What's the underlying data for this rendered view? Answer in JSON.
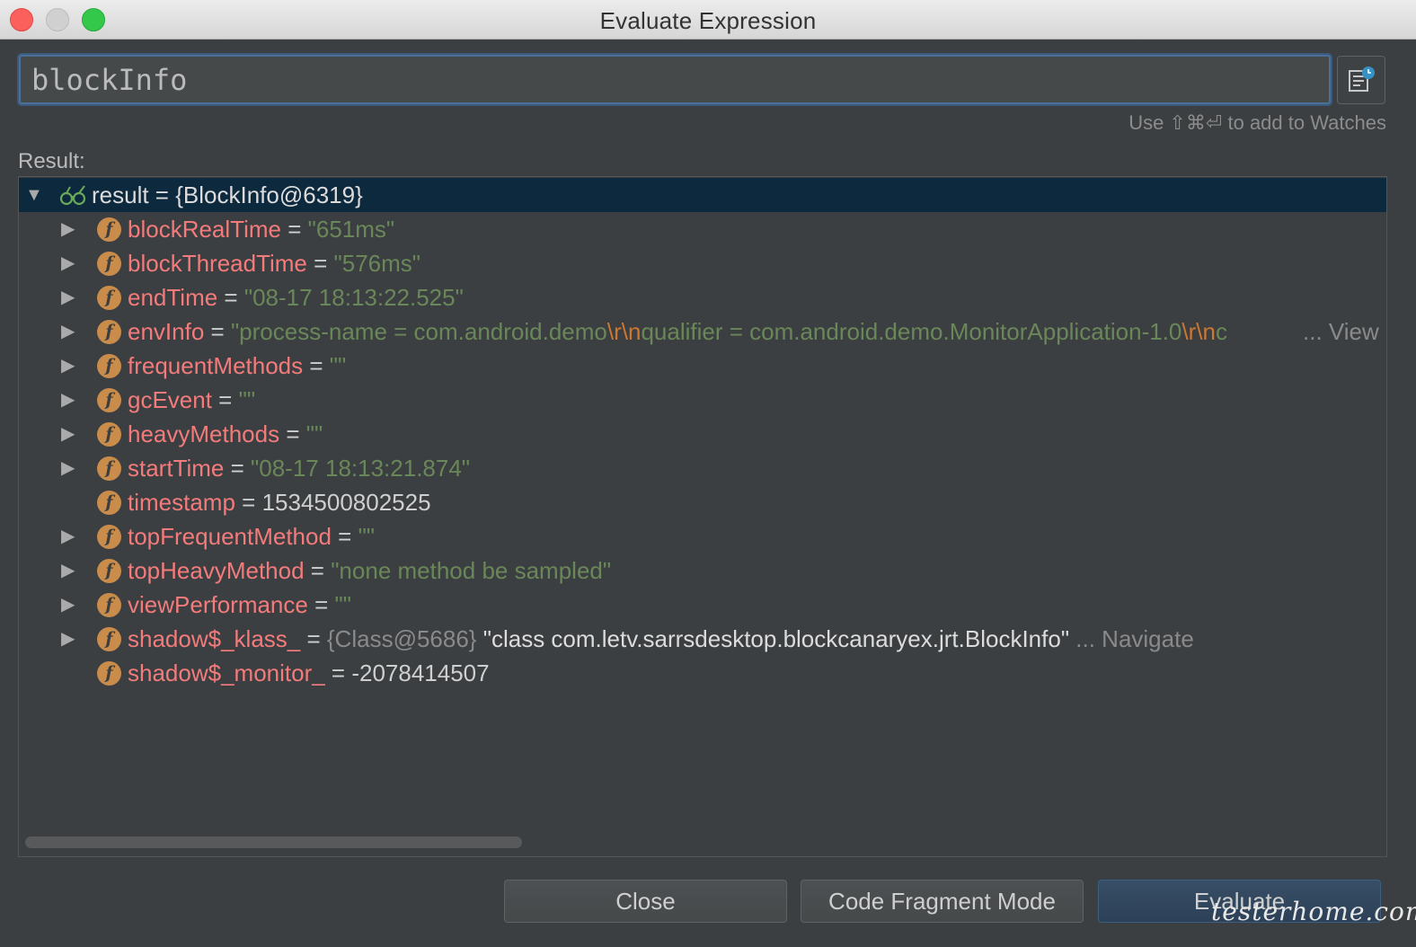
{
  "window": {
    "title": "Evaluate Expression"
  },
  "expression": {
    "value": "blockInfo"
  },
  "hint": "Use ⇧⌘⏎ to add to Watches",
  "result_label": "Result:",
  "root": {
    "name": "result",
    "eq": " = ",
    "value": "{BlockInfo@6319}"
  },
  "fields": [
    {
      "name": "blockRealTime",
      "eq": " = ",
      "value": "\"651ms\""
    },
    {
      "name": "blockThreadTime",
      "eq": " = ",
      "value": "\"576ms\""
    },
    {
      "name": "endTime",
      "eq": " = ",
      "value": "\"08-17 18:13:22.525\""
    },
    {
      "name": "envInfo",
      "eq": " = ",
      "v1": "\"process-name = com.android.demo",
      "e1": "\\r\\n",
      "v2": "qualifier = com.android.demo.MonitorApplication-1.0",
      "e2": "\\r\\n",
      "v3": "c",
      "more": "... View"
    },
    {
      "name": "frequentMethods",
      "eq": " = ",
      "value": "\"\""
    },
    {
      "name": "gcEvent",
      "eq": " = ",
      "value": "\"\""
    },
    {
      "name": "heavyMethods",
      "eq": " = ",
      "value": "\"\""
    },
    {
      "name": "startTime",
      "eq": " = ",
      "value": "\"08-17 18:13:21.874\""
    },
    {
      "name": "timestamp",
      "eq": " = ",
      "value": "1534500802525"
    },
    {
      "name": "topFrequentMethod",
      "eq": " = ",
      "value": "\"\""
    },
    {
      "name": "topHeavyMethod",
      "eq": " = ",
      "value": "\"none method be sampled\""
    },
    {
      "name": "viewPerformance",
      "eq": " = ",
      "value": "\"\""
    },
    {
      "name": "shadow$_klass_",
      "eq": " = ",
      "ref": "{Class@5686}",
      "value": " \"class com.letv.sarrsdesktop.blockcanaryex.jrt.BlockInfo\"",
      "more": " ... Navigate"
    },
    {
      "name": "shadow$_monitor_",
      "eq": " = ",
      "value": "-2078414507"
    }
  ],
  "field_icon": "f",
  "buttons": {
    "close": "Close",
    "code_fragment": "Code Fragment Mode",
    "evaluate": "Evaluate"
  },
  "watermark": "testerhome.com"
}
